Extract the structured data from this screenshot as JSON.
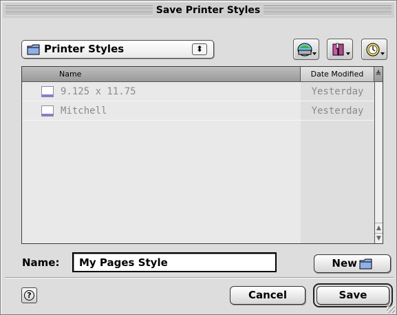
{
  "window": {
    "title": "Save Printer Styles"
  },
  "folder_popup": {
    "label": "Printer Styles",
    "icon": "folder-icon"
  },
  "toolbar": {
    "buttons": [
      {
        "name": "shortcuts-button",
        "icon": "drive-icon"
      },
      {
        "name": "favorites-button",
        "icon": "favorites-icon"
      },
      {
        "name": "recent-button",
        "icon": "clock-icon"
      }
    ]
  },
  "file_list": {
    "columns": {
      "name": "Name",
      "date": "Date Modified",
      "sort_indicator": "≜"
    },
    "rows": [
      {
        "name": "9.125 x 11.75",
        "date": "Yesterday",
        "icon": "document-icon"
      },
      {
        "name": "Mitchell",
        "date": "Yesterday",
        "icon": "document-icon"
      }
    ]
  },
  "name_field": {
    "label": "Name:",
    "value": "My Pages Style"
  },
  "buttons": {
    "new": "New",
    "cancel": "Cancel",
    "save": "Save",
    "help": "?"
  }
}
